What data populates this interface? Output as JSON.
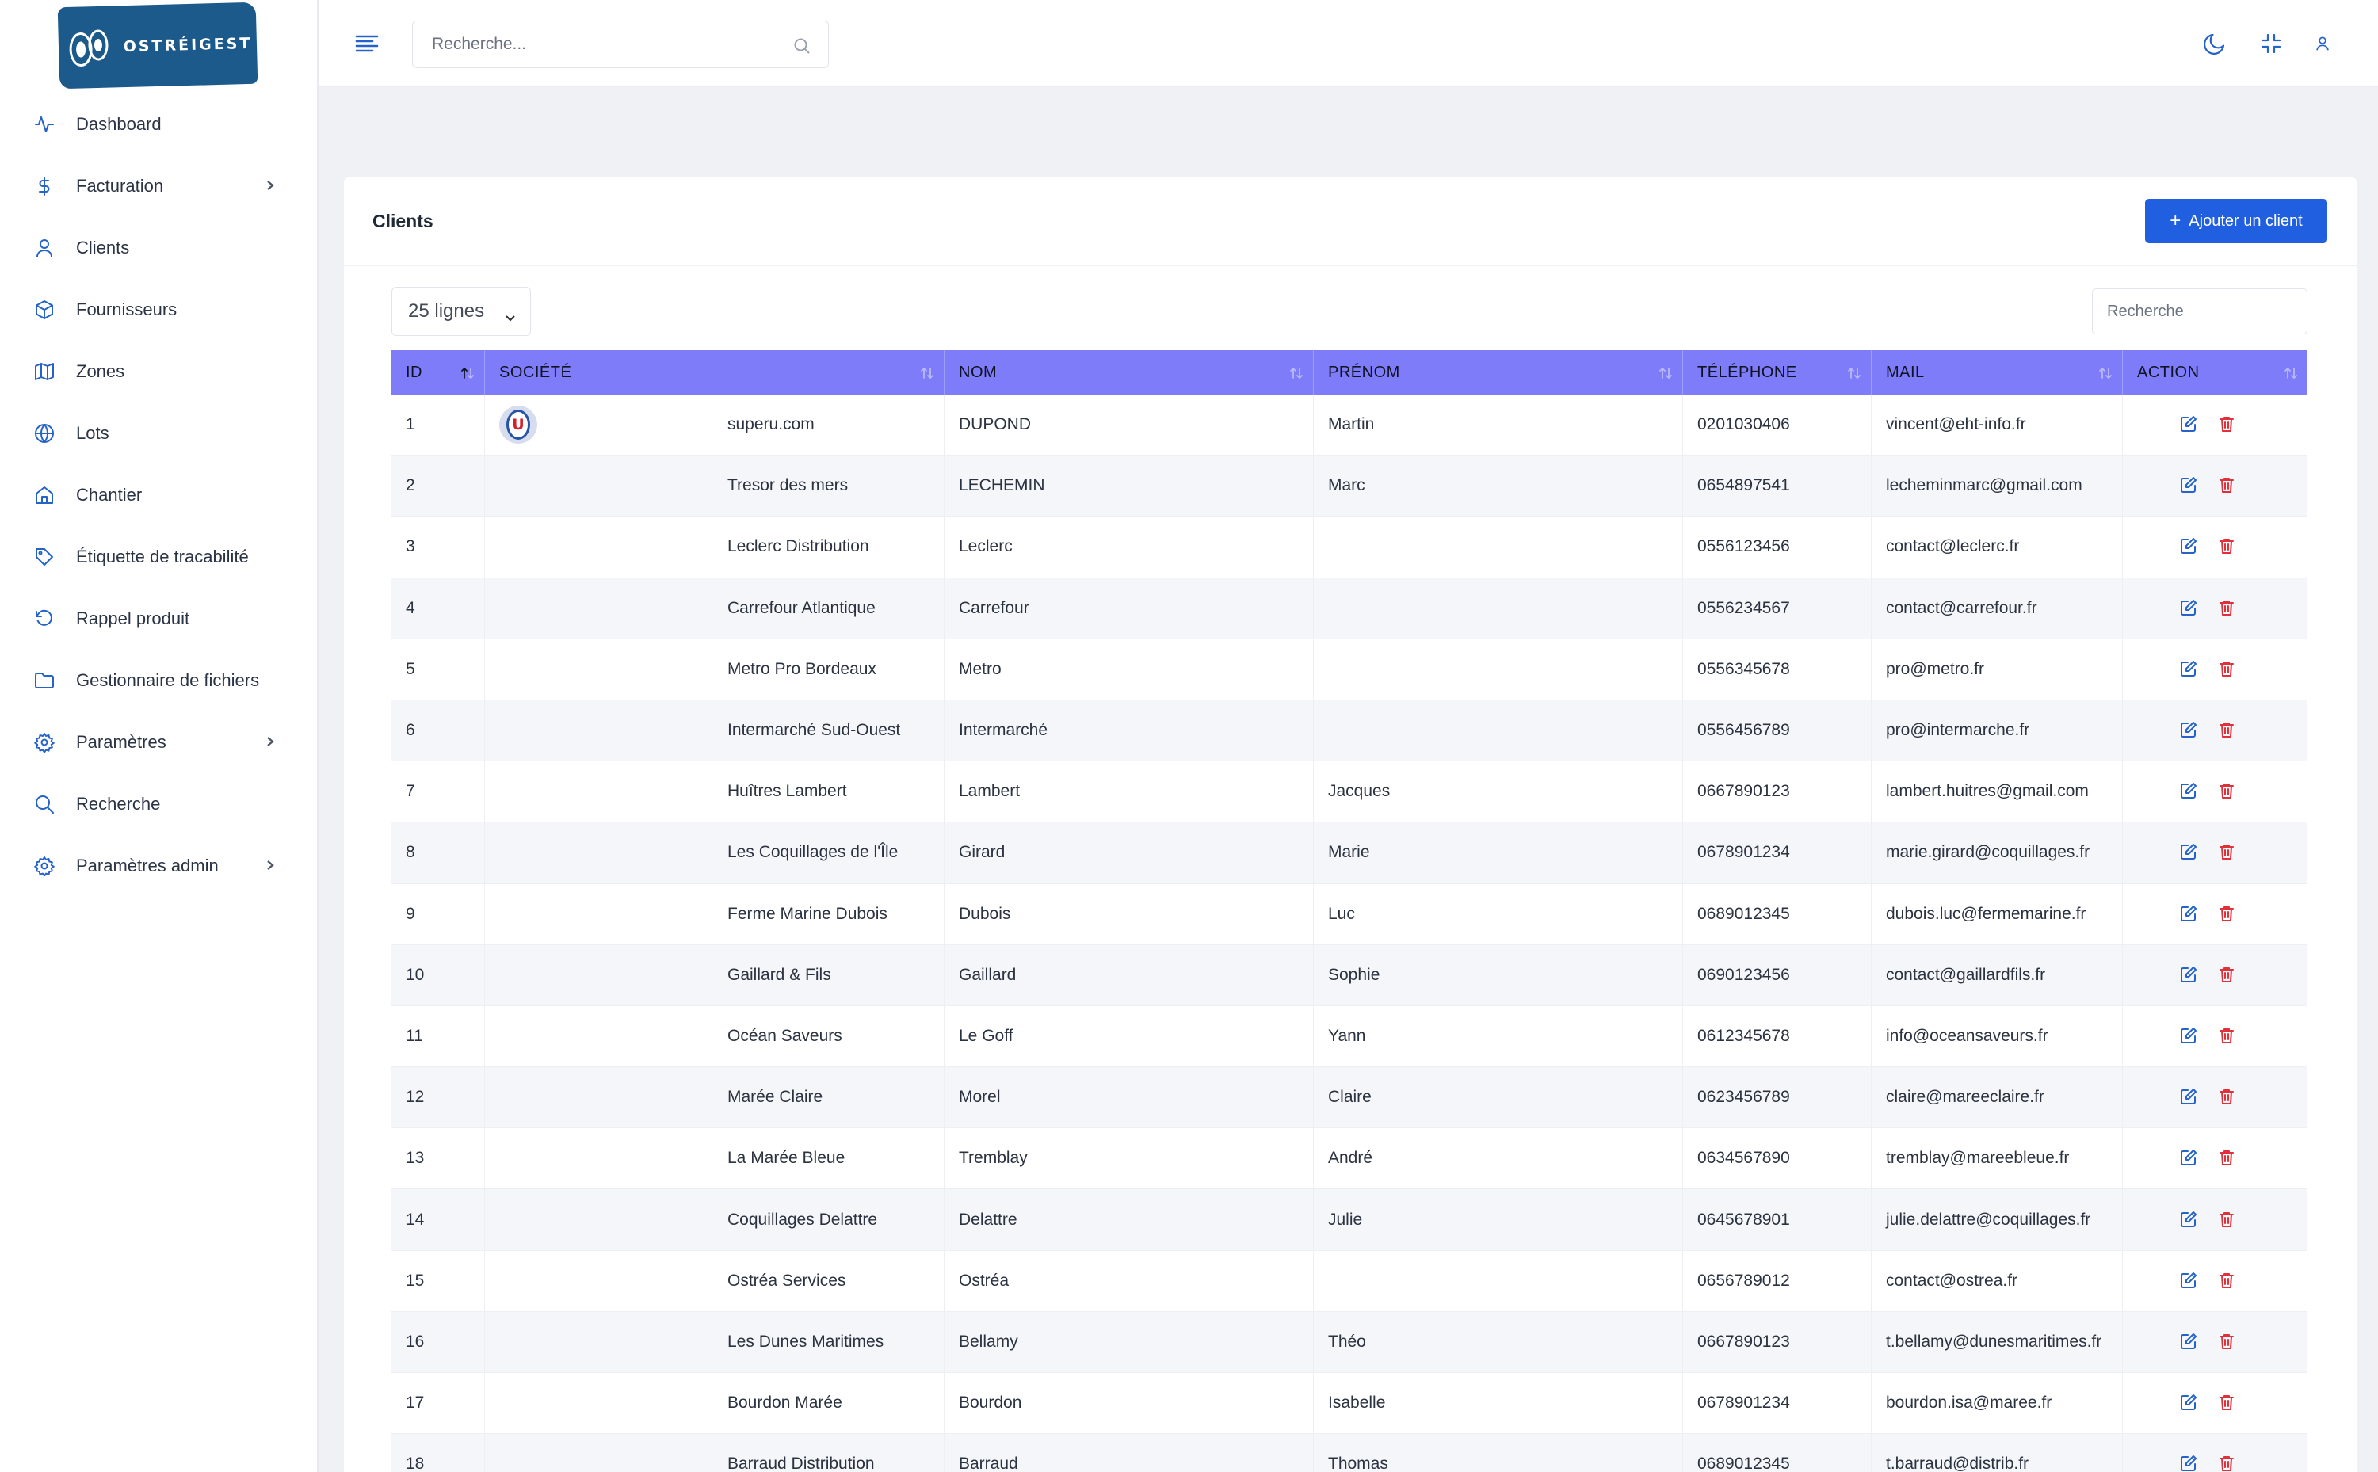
{
  "brand": {
    "logo_text": "OSTRÉIGEST"
  },
  "sidebar": {
    "items": [
      {
        "label": "Dashboard",
        "icon": "activity-icon",
        "has_children": false
      },
      {
        "label": "Facturation",
        "icon": "dollar-icon",
        "has_children": true
      },
      {
        "label": "Clients",
        "icon": "user-icon",
        "has_children": false
      },
      {
        "label": "Fournisseurs",
        "icon": "box-icon",
        "has_children": false
      },
      {
        "label": "Zones",
        "icon": "map-icon",
        "has_children": false
      },
      {
        "label": "Lots",
        "icon": "globe-icon",
        "has_children": false
      },
      {
        "label": "Chantier",
        "icon": "home-icon",
        "has_children": false
      },
      {
        "label": "Étiquette de tracabilité",
        "icon": "tag-icon",
        "has_children": false
      },
      {
        "label": "Rappel produit",
        "icon": "rotate-ccw-icon",
        "has_children": false
      },
      {
        "label": "Gestionnaire de fichiers",
        "icon": "folder-icon",
        "has_children": false
      },
      {
        "label": "Paramètres",
        "icon": "settings-icon",
        "has_children": true
      },
      {
        "label": "Recherche",
        "icon": "search-icon",
        "has_children": false
      },
      {
        "label": "Paramètres admin",
        "icon": "settings-icon",
        "has_children": true
      }
    ]
  },
  "topbar": {
    "search_placeholder": "Recherche...",
    "icons": [
      "menu-icon",
      "search-icon",
      "moon-icon",
      "minimize-icon",
      "user-icon"
    ]
  },
  "page": {
    "title": "Clients",
    "add_button": "Ajouter un client",
    "rows_select": "25 lignes",
    "table_search_placeholder": "Recherche"
  },
  "colors": {
    "accent": "#1f5fe0",
    "header_bg": "#7f7cf9",
    "icon_blue": "#2563c9",
    "delete_red": "#e0303a",
    "logo_blue": "#1d5a8c"
  },
  "table": {
    "columns": [
      "ID",
      "SOCIÉTÉ",
      "NOM",
      "PRÉNOM",
      "TÉLÉPHONE",
      "MAIL",
      "ACTION"
    ],
    "rows": [
      {
        "id": "1",
        "logo": "U",
        "societe": "superu.com",
        "nom": "DUPOND",
        "prenom": "Martin",
        "tel": "0201030406",
        "mail": "vincent@eht-info.fr"
      },
      {
        "id": "2",
        "logo": "",
        "societe": "Tresor des mers",
        "nom": "LECHEMIN",
        "prenom": "Marc",
        "tel": "0654897541",
        "mail": "lecheminmarc@gmail.com"
      },
      {
        "id": "3",
        "logo": "",
        "societe": "Leclerc Distribution",
        "nom": "Leclerc",
        "prenom": "",
        "tel": "0556123456",
        "mail": "contact@leclerc.fr"
      },
      {
        "id": "4",
        "logo": "",
        "societe": "Carrefour Atlantique",
        "nom": "Carrefour",
        "prenom": "",
        "tel": "0556234567",
        "mail": "contact@carrefour.fr"
      },
      {
        "id": "5",
        "logo": "",
        "societe": "Metro Pro Bordeaux",
        "nom": "Metro",
        "prenom": "",
        "tel": "0556345678",
        "mail": "pro@metro.fr"
      },
      {
        "id": "6",
        "logo": "",
        "societe": "Intermarché Sud-Ouest",
        "nom": "Intermarché",
        "prenom": "",
        "tel": "0556456789",
        "mail": "pro@intermarche.fr"
      },
      {
        "id": "7",
        "logo": "",
        "societe": "Huîtres Lambert",
        "nom": "Lambert",
        "prenom": "Jacques",
        "tel": "0667890123",
        "mail": "lambert.huitres@gmail.com"
      },
      {
        "id": "8",
        "logo": "",
        "societe": "Les Coquillages de l'Île",
        "nom": "Girard",
        "prenom": "Marie",
        "tel": "0678901234",
        "mail": "marie.girard@coquillages.fr"
      },
      {
        "id": "9",
        "logo": "",
        "societe": "Ferme Marine Dubois",
        "nom": "Dubois",
        "prenom": "Luc",
        "tel": "0689012345",
        "mail": "dubois.luc@fermemarine.fr"
      },
      {
        "id": "10",
        "logo": "",
        "societe": "Gaillard & Fils",
        "nom": "Gaillard",
        "prenom": "Sophie",
        "tel": "0690123456",
        "mail": "contact@gaillardfils.fr"
      },
      {
        "id": "11",
        "logo": "",
        "societe": "Océan Saveurs",
        "nom": "Le Goff",
        "prenom": "Yann",
        "tel": "0612345678",
        "mail": "info@oceansaveurs.fr"
      },
      {
        "id": "12",
        "logo": "",
        "societe": "Marée Claire",
        "nom": "Morel",
        "prenom": "Claire",
        "tel": "0623456789",
        "mail": "claire@mareeclaire.fr"
      },
      {
        "id": "13",
        "logo": "",
        "societe": "La Marée Bleue",
        "nom": "Tremblay",
        "prenom": "André",
        "tel": "0634567890",
        "mail": "tremblay@mareebleue.fr"
      },
      {
        "id": "14",
        "logo": "",
        "societe": "Coquillages Delattre",
        "nom": "Delattre",
        "prenom": "Julie",
        "tel": "0645678901",
        "mail": "julie.delattre@coquillages.fr"
      },
      {
        "id": "15",
        "logo": "",
        "societe": "Ostréa Services",
        "nom": "Ostréa",
        "prenom": "",
        "tel": "0656789012",
        "mail": "contact@ostrea.fr"
      },
      {
        "id": "16",
        "logo": "",
        "societe": "Les Dunes Maritimes",
        "nom": "Bellamy",
        "prenom": "Théo",
        "tel": "0667890123",
        "mail": "t.bellamy@dunesmaritimes.fr"
      },
      {
        "id": "17",
        "logo": "",
        "societe": "Bourdon Marée",
        "nom": "Bourdon",
        "prenom": "Isabelle",
        "tel": "0678901234",
        "mail": "bourdon.isa@maree.fr"
      },
      {
        "id": "18",
        "logo": "",
        "societe": "Barraud Distribution",
        "nom": "Barraud",
        "prenom": "Thomas",
        "tel": "0689012345",
        "mail": "t.barraud@distrib.fr"
      }
    ]
  }
}
